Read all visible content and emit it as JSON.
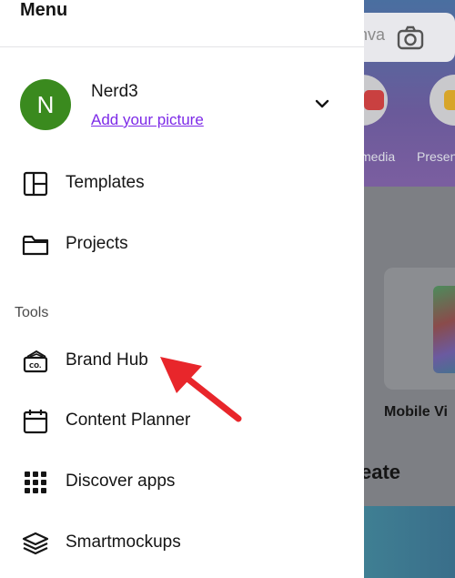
{
  "menu": {
    "title": "Menu",
    "profile": {
      "initial": "N",
      "name": "Nerd3",
      "add_picture_link": "Add your picture",
      "avatar_color": "#3a8a1e"
    },
    "items": [
      {
        "label": "Templates",
        "icon": "templates-icon"
      },
      {
        "label": "Projects",
        "icon": "folder-icon"
      }
    ],
    "tools_section_label": "Tools",
    "tools": [
      {
        "label": "Brand Hub",
        "icon": "brand-hub-icon"
      },
      {
        "label": "Content Planner",
        "icon": "calendar-icon"
      },
      {
        "label": "Discover apps",
        "icon": "apps-grid-icon"
      },
      {
        "label": "Smartmockups",
        "icon": "layers-icon"
      }
    ]
  },
  "background": {
    "search_partial": "nva",
    "category_labels": [
      "media",
      "Presen"
    ],
    "card_label": "Mobile Vi",
    "heading_partial": "eate"
  },
  "colors": {
    "link_purple": "#7d2ae8",
    "annotation_arrow": "#e8262b"
  }
}
